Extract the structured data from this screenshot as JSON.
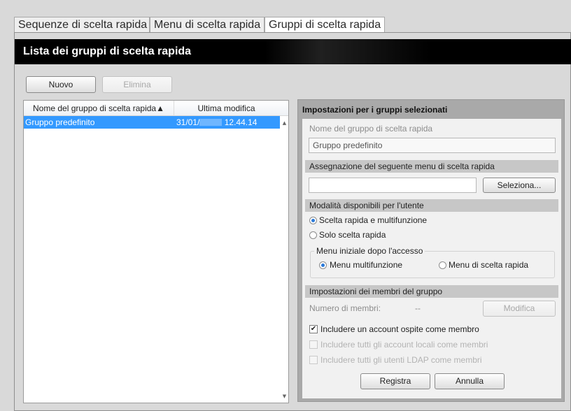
{
  "tabs": [
    {
      "label": "Sequenze di scelta rapida",
      "active": false
    },
    {
      "label": "Menu di scelta rapida",
      "active": false
    },
    {
      "label": "Gruppi di scelta rapida",
      "active": true
    }
  ],
  "page": {
    "title": "Lista dei gruppi di scelta rapida"
  },
  "toolbar": {
    "new_label": "Nuovo",
    "delete_label": "Elimina"
  },
  "list": {
    "columns": {
      "name": "Nome del gruppo di scelta rapida▲",
      "modified": "Ultima modifica"
    },
    "rows": [
      {
        "name": "Gruppo predefinito",
        "date_prefix": "31/01/",
        "time": "12.44.14",
        "selected": true
      }
    ]
  },
  "settings": {
    "title": "Impostazioni per i gruppi selezionati",
    "group_name_label": "Nome del gruppo di scelta rapida",
    "group_name_value": "Gruppo predefinito",
    "menu_section": "Assegnazione del seguente menu di scelta rapida",
    "menu_value": "",
    "select_label": "Seleziona...",
    "modes_section": "Modalità disponibili per l'utente",
    "mode_options": [
      {
        "label": "Scelta rapida e multifunzione",
        "selected": true
      },
      {
        "label": "Solo scelta rapida",
        "selected": false
      }
    ],
    "initial_menu": {
      "legend": "Menu iniziale dopo l'accesso",
      "options": [
        {
          "label": "Menu multifunzione",
          "selected": true
        },
        {
          "label": "Menu di scelta rapida",
          "selected": false
        }
      ]
    },
    "members_section": "Impostazioni dei membri del gruppo",
    "members_count_label": "Numero di membri:",
    "members_count_value": "--",
    "modify_label": "Modifica",
    "checkboxes": [
      {
        "label": "Includere un account ospite come membro",
        "checked": true,
        "enabled": true
      },
      {
        "label": "Includere tutti gli account locali come membri",
        "checked": false,
        "enabled": false
      },
      {
        "label": "Includere tutti gli utenti LDAP come membri",
        "checked": false,
        "enabled": false
      }
    ],
    "register_label": "Registra",
    "cancel_label": "Annulla"
  },
  "colors": {
    "selection": "#3399ff",
    "radio_accent": "#2a79d8",
    "banner": "#000000"
  },
  "icons": {
    "sort": "sort-ascending-icon",
    "scroll_up": "scroll-up-arrow-icon",
    "scroll_down": "scroll-down-arrow-icon",
    "check": "checkmark-icon"
  }
}
